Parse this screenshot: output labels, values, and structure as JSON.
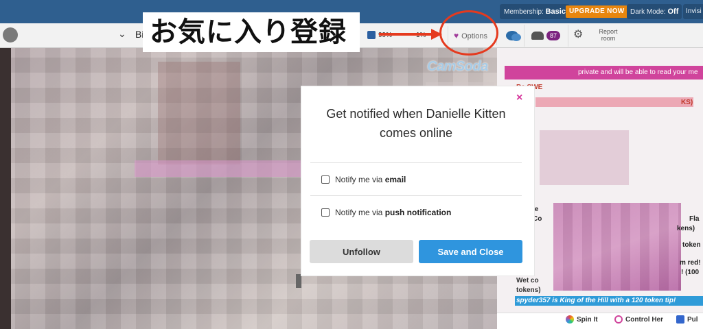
{
  "topbar": {
    "membership_label": "Membership:",
    "membership_value": "Basic",
    "upgrade_label": "UPGRADE NOW",
    "dark_mode_label": "Dark Mode:",
    "dark_mode_value": "Off",
    "invisible_label": "Invisi"
  },
  "toolbar": {
    "model_name_fragment": "Bi",
    "like_percent": "99%",
    "dislike_percent": "1%",
    "options_label": "Options",
    "user_count": "87",
    "report_label": "Report room"
  },
  "annotation": {
    "jp_label": "お気に入り登録",
    "arrow_color": "#e53a1e"
  },
  "video": {
    "watermark": "CamSoda"
  },
  "modal": {
    "title": "Get notified when Danielle Kitten comes online",
    "email_prefix": "Notify me via ",
    "email_bold": "email",
    "push_prefix": "Notify me via ",
    "push_bold": "push notification",
    "unfollow_label": "Unfollow",
    "save_label": "Save and Close",
    "close_glyph": "×"
  },
  "chat": {
    "pinned_notice": "private and will be able to read your me",
    "fragments": {
      "be_swe": "Be SWE",
      "ks": "KS)",
      "fla": "Fla",
      "kens": "kens)",
      "token": "token",
      "m_red": "m red!",
      "hundred": "! (100",
      "le": "le",
      "co": "Co",
      "wet": "Wet co",
      "tokens": "tokens)"
    },
    "king_message": "spyder357 is King of the Hill with a 120 token tip!",
    "bottom_buttons": [
      "Spin It",
      "Control Her",
      "Pul"
    ]
  },
  "colors": {
    "topbar": "#2f5f8f",
    "upgrade": "#e8860e",
    "accent_pink": "#d0449c",
    "save_blue": "#2f95de",
    "close_pink": "#d5339a"
  }
}
